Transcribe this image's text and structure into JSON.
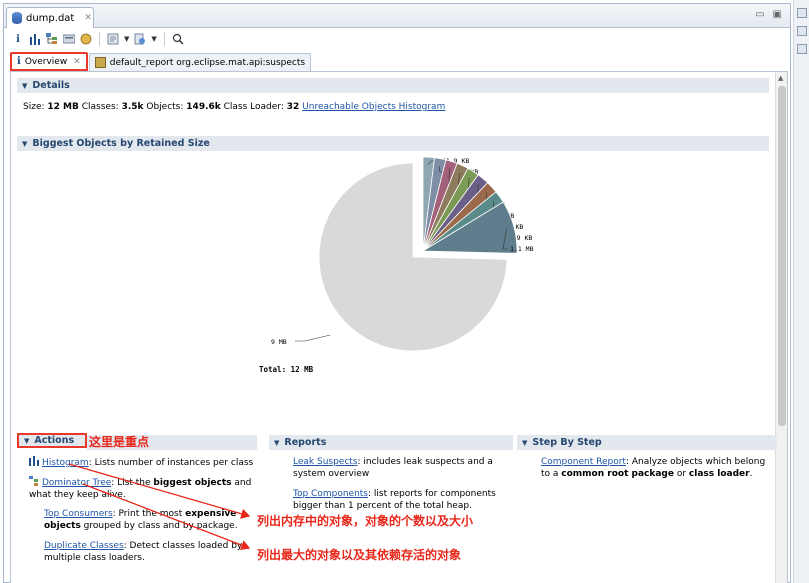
{
  "editor": {
    "tab_title": "dump.dat"
  },
  "tabs": [
    {
      "label": "Overview"
    },
    {
      "label": "default_report  org.eclipse.mat.api:suspects"
    }
  ],
  "details": {
    "header": "Details",
    "size_label": "Size:",
    "size_value": "12 MB",
    "classes_label": "Classes:",
    "classes_value": "3.5k",
    "objects_label": "Objects:",
    "objects_value": "149.6k",
    "loader_label": "Class Loader:",
    "loader_value": "32",
    "unreachable_link": "Unreachable Objects Histogram"
  },
  "biggest": {
    "header": "Biggest Objects by Retained Size",
    "labels": [
      "241.9 KB",
      "242.9 KB",
      "246.1 KB",
      "250 KB",
      "253.1 KB",
      "255.8 KB",
      "259.9 KB",
      "260.9 KB",
      "1.1 MB",
      "9 MB"
    ],
    "total": "Total: 12 MB"
  },
  "chart_data": {
    "type": "pie",
    "categories": [
      "241.9 KB",
      "242.9 KB",
      "246.1 KB",
      "250 KB",
      "253.1 KB",
      "255.8 KB",
      "259.9 KB",
      "260.9 KB",
      "1.1 MB",
      "9 MB"
    ],
    "values": [
      241.9,
      242.9,
      246.1,
      250,
      253.1,
      255.8,
      259.9,
      260.9,
      1126,
      9216
    ],
    "colors": [
      "#8fa7b3",
      "#7e8ea6",
      "#a4617c",
      "#8e7b5e",
      "#7a9a56",
      "#6b5f88",
      "#9a6a4a",
      "#5a8a8a",
      "#5f7d8c",
      "#d9d9d9"
    ]
  },
  "actions": {
    "header": "Actions",
    "histogram_link": "Histogram",
    "histogram_text": ": Lists number of instances per class",
    "dominator_link": "Dominator Tree",
    "dominator_text_1": ": List the ",
    "dominator_bold": "biggest objects",
    "dominator_text_2": " and",
    "dominator_text_3": "what they keep alive.",
    "consumers_link": "Top Consumers",
    "consumers_text_1": ": Print the most ",
    "consumers_bold_1": "expensive",
    "consumers_bold_2": "objects",
    "consumers_text_2": " grouped by class and by package.",
    "duplicate_link": "Duplicate Classes",
    "duplicate_text_1": ": Detect classes loaded by",
    "duplicate_text_2": "multiple class loaders."
  },
  "reports": {
    "header": "Reports",
    "leak_link": "Leak Suspects",
    "leak_text_1": ": includes leak suspects and a",
    "leak_text_2": "system overview",
    "topcomp_link": "Top Components",
    "topcomp_text_1": ": list reports for components",
    "topcomp_text_2": "bigger than 1 percent of the total heap."
  },
  "step": {
    "header": "Step By Step",
    "comp_link": "Component Report",
    "comp_text_1": ": Analyze objects which belong",
    "comp_text_2": "to a ",
    "comp_bold_1": "common root package",
    "comp_text_3": " or ",
    "comp_bold_2": "class loader",
    "comp_text_4": "."
  },
  "annotations": {
    "focus": "这里是重点",
    "histogram_note": "列出内存中的对象，对象的个数以及大小",
    "dominator_note": "列出最大的对象以及其依赖存活的对象"
  }
}
